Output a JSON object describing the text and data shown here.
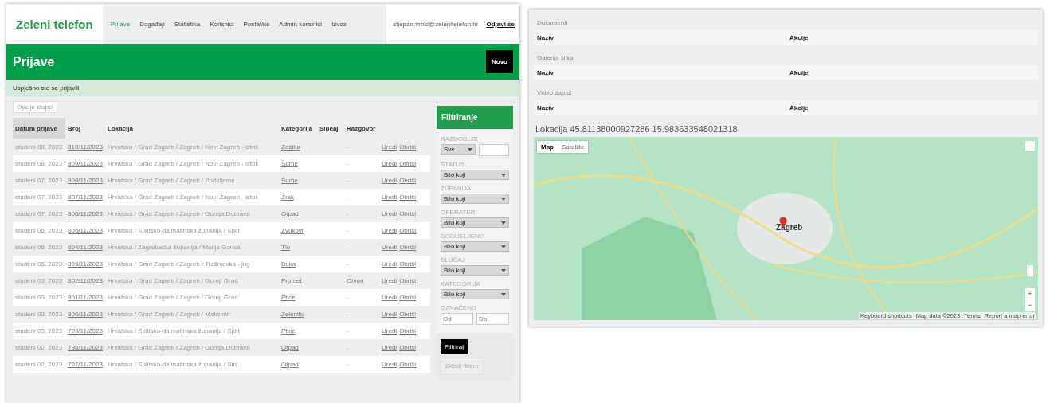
{
  "header": {
    "logo": "Zeleni telefon",
    "nav": [
      {
        "label": "Prijave",
        "selected": true
      },
      {
        "label": "Događaji",
        "selected": false
      },
      {
        "label": "Statistika",
        "selected": false
      },
      {
        "label": "Korisnici",
        "selected": false
      },
      {
        "label": "Postavke",
        "selected": false
      },
      {
        "label": "Admin korisnici",
        "selected": false
      },
      {
        "label": "Izvoz",
        "selected": false
      }
    ],
    "user": "stjepan.vrbic@zelenitelefon.hr",
    "logout": "Odjavi se"
  },
  "banner": {
    "title": "Prijave",
    "new_button": "Novo"
  },
  "alert": "Uspješno ste se prijavili.",
  "columns_button": "Opcije stupci",
  "table": {
    "columns": [
      {
        "label": "Datum prijave",
        "sorted": true
      },
      {
        "label": "Broj",
        "sorted": false
      },
      {
        "label": "Lokacija",
        "sorted": false
      },
      {
        "label": "Kategorija",
        "sorted": false
      },
      {
        "label": "Slučaj",
        "sorted": false
      },
      {
        "label": "Razgovor",
        "sorted": false
      }
    ],
    "rows": [
      {
        "date": "studeni 08, 2023",
        "number": "810/11/2023",
        "location": "Hrvatska / Grad Zagreb / Zagreb / Novi Zagreb - istok",
        "category": "Zaštita",
        "case": "",
        "talk": "-",
        "actions": [
          "Uredi",
          "Obriši"
        ]
      },
      {
        "date": "studeni 08, 2023",
        "number": "809/11/2023",
        "location": "Hrvatska / Grad Zagreb / Zagreb / Novi Zagreb - istok",
        "category": "Šume",
        "case": "",
        "talk": "-",
        "actions": [
          "Uredi",
          "Obriši"
        ]
      },
      {
        "date": "studeni 07, 2023",
        "number": "808/11/2023",
        "location": "Hrvatska / Grad Zagreb / Zagreb / Podsljeme",
        "category": "Šume",
        "case": "",
        "talk": "-",
        "actions": [
          "Uredi",
          "Obriši"
        ]
      },
      {
        "date": "studeni 07, 2023",
        "number": "807/11/2023",
        "location": "Hrvatska / Grad Zagreb / Zagreb / Novi Zagreb - istok",
        "category": "Zrak",
        "case": "",
        "talk": "-",
        "actions": [
          "Uredi",
          "Obriši"
        ]
      },
      {
        "date": "studeni 07, 2023",
        "number": "806/11/2023",
        "location": "Hrvatska / Grad Zagreb / Zagreb / Gornja Dubrava",
        "category": "Otpad",
        "case": "",
        "talk": "-",
        "actions": [
          "Uredi",
          "Obriši"
        ]
      },
      {
        "date": "studeni 06, 2023",
        "number": "805/11/2023",
        "location": "Hrvatska / Splitsko-dalmatinska županija / Split",
        "category": "Zvukovi",
        "case": "",
        "talk": "-",
        "actions": [
          "Uredi",
          "Obriši"
        ]
      },
      {
        "date": "studeni 06, 2023",
        "number": "804/11/2023",
        "location": "Hrvatska / Zagrebačka županija / Marija Gorica",
        "category": "Tlo",
        "case": "",
        "talk": "-",
        "actions": [
          "Uredi",
          "Obriši"
        ]
      },
      {
        "date": "studeni 06, 2023",
        "number": "803/11/2023",
        "location": "Hrvatska / Grad Zagreb / Zagreb / Trešnjevka - jug",
        "category": "Buka",
        "case": "",
        "talk": "-",
        "actions": [
          "Uredi",
          "Obriši"
        ]
      },
      {
        "date": "studeni 03, 2023",
        "number": "802/11/2023",
        "location": "Hrvatska / Grad Zagreb / Zagreb / Gornji Grad",
        "category": "Promet",
        "case": "",
        "talk": "Otvori",
        "actions": [
          "Uredi",
          "Obriši"
        ]
      },
      {
        "date": "studeni 03, 2023",
        "number": "801/11/2023",
        "location": "Hrvatska / Grad Zagreb / Zagreb / Gornji Grad",
        "category": "Ptice",
        "case": "",
        "talk": "-",
        "actions": [
          "Uredi",
          "Obriši"
        ]
      },
      {
        "date": "studeni 03, 2023",
        "number": "800/11/2023",
        "location": "Hrvatska / Grad Zagreb / Zagreb / Maksimir",
        "category": "Zelenilo",
        "case": "",
        "talk": "-",
        "actions": [
          "Uredi",
          "Obriši"
        ]
      },
      {
        "date": "studeni 03, 2023",
        "number": "799/11/2023",
        "location": "Hrvatska / Splitsko-dalmatinska županija / Split",
        "category": "Ptice",
        "case": "",
        "talk": "-",
        "actions": [
          "Uredi",
          "Obriši"
        ]
      },
      {
        "date": "studeni 02, 2023",
        "number": "798/11/2023",
        "location": "Hrvatska / Grad Zagreb / Zagreb / Gornja Dubrava",
        "category": "Otpad",
        "case": "",
        "talk": "-",
        "actions": [
          "Uredi",
          "Obriši"
        ]
      },
      {
        "date": "studeni 02, 2023",
        "number": "797/11/2023",
        "location": "Hrvatska / Splitsko-dalmatinska županija / Sinj",
        "category": "Otpad",
        "case": "",
        "talk": "-",
        "actions": [
          "Uredi",
          "Obriši"
        ]
      }
    ]
  },
  "filter": {
    "title": "Filtriranje",
    "fields": [
      {
        "kind": "range",
        "label": "RAZDOBLJE",
        "value": "Sve"
      },
      {
        "kind": "select",
        "label": "STATUS",
        "value": "Bilo koji"
      },
      {
        "kind": "select",
        "label": "ŽUPANIJA",
        "value": "Bilo koji"
      },
      {
        "kind": "select",
        "label": "OPERATER",
        "value": "Bilo koji"
      },
      {
        "kind": "select",
        "label": "DODIJELJENO",
        "value": "Bilo koji"
      },
      {
        "kind": "select",
        "label": "SLUČAJ",
        "value": "Bilo koji"
      },
      {
        "kind": "select",
        "label": "KATEGORIJA",
        "value": "Bilo koji"
      },
      {
        "kind": "pair",
        "label": "OZNAČENO",
        "placeholders": [
          "Od",
          "Do"
        ]
      }
    ],
    "apply": "Filtriraj",
    "clear": "Očisti filtere"
  },
  "detail": {
    "sections": [
      {
        "label": "Dokumenti",
        "columns": [
          "Naziv",
          "Akcije"
        ]
      },
      {
        "label": "Galerija slika",
        "columns": [
          "Naziv",
          "Akcije"
        ]
      },
      {
        "label": "Video zapisi",
        "columns": [
          "Naziv",
          "Akcije"
        ]
      }
    ],
    "location": "Lokacija 45.81138000927286 15.983633548021318",
    "map": {
      "types": [
        {
          "label": "Map",
          "selected": true
        },
        {
          "label": "Satellite",
          "selected": false
        }
      ],
      "city": "Zagreb",
      "zoom": [
        "+",
        "−"
      ],
      "attribution": [
        "Keyboard shortcuts",
        "Map data ©2023",
        "Terms",
        "Report a map error"
      ]
    }
  }
}
